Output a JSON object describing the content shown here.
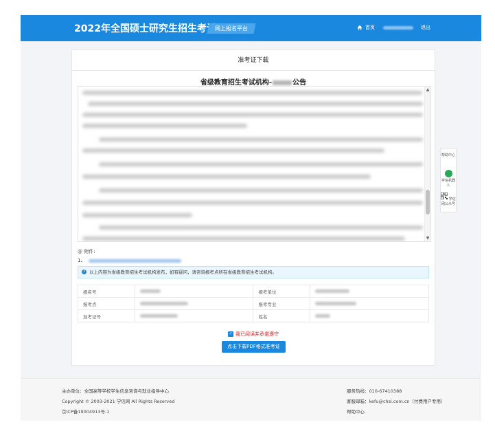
{
  "header": {
    "title": "2022年全国硕士研究生招生考试",
    "platform_tag": "网上报名平台",
    "home": "首页",
    "logout": "退出"
  },
  "card": {
    "title": "准考证下载",
    "notice_title_prefix": "省级教育招生考试机构-",
    "notice_title_suffix": "公告"
  },
  "attachments": {
    "label": "附件:",
    "item_index": "1、"
  },
  "info_message": "以上内容为省级教育招生考试机构发布，如有疑问，请咨询报考点所在省级教育招生考试机构。",
  "table": {
    "registration_no": "报名号",
    "exam_unit": "报考单位",
    "exam_site": "报考点",
    "exam_major": "报考专业",
    "id_no": "准考证号",
    "name": "姓名"
  },
  "agree_text": "我已阅读并承诺遵守",
  "download_button": "点击下载PDF格式准考证",
  "side_tools": {
    "help": "帮助中心",
    "robot": "学信机器人",
    "wechat": "学信网公众号"
  },
  "footer": {
    "organizer": "主办单位：全国高等学校学生信息咨询与就业指导中心",
    "copyright": "Copyright © 2003-2021 学信网 All Rights Reserved",
    "icp": "京ICP备19004913号-1",
    "hotline": "服务热线：010-67410388",
    "email": "客服邮箱：kefu@chsi.com.cn（付费用户专用）",
    "help_center": "帮助中心"
  }
}
